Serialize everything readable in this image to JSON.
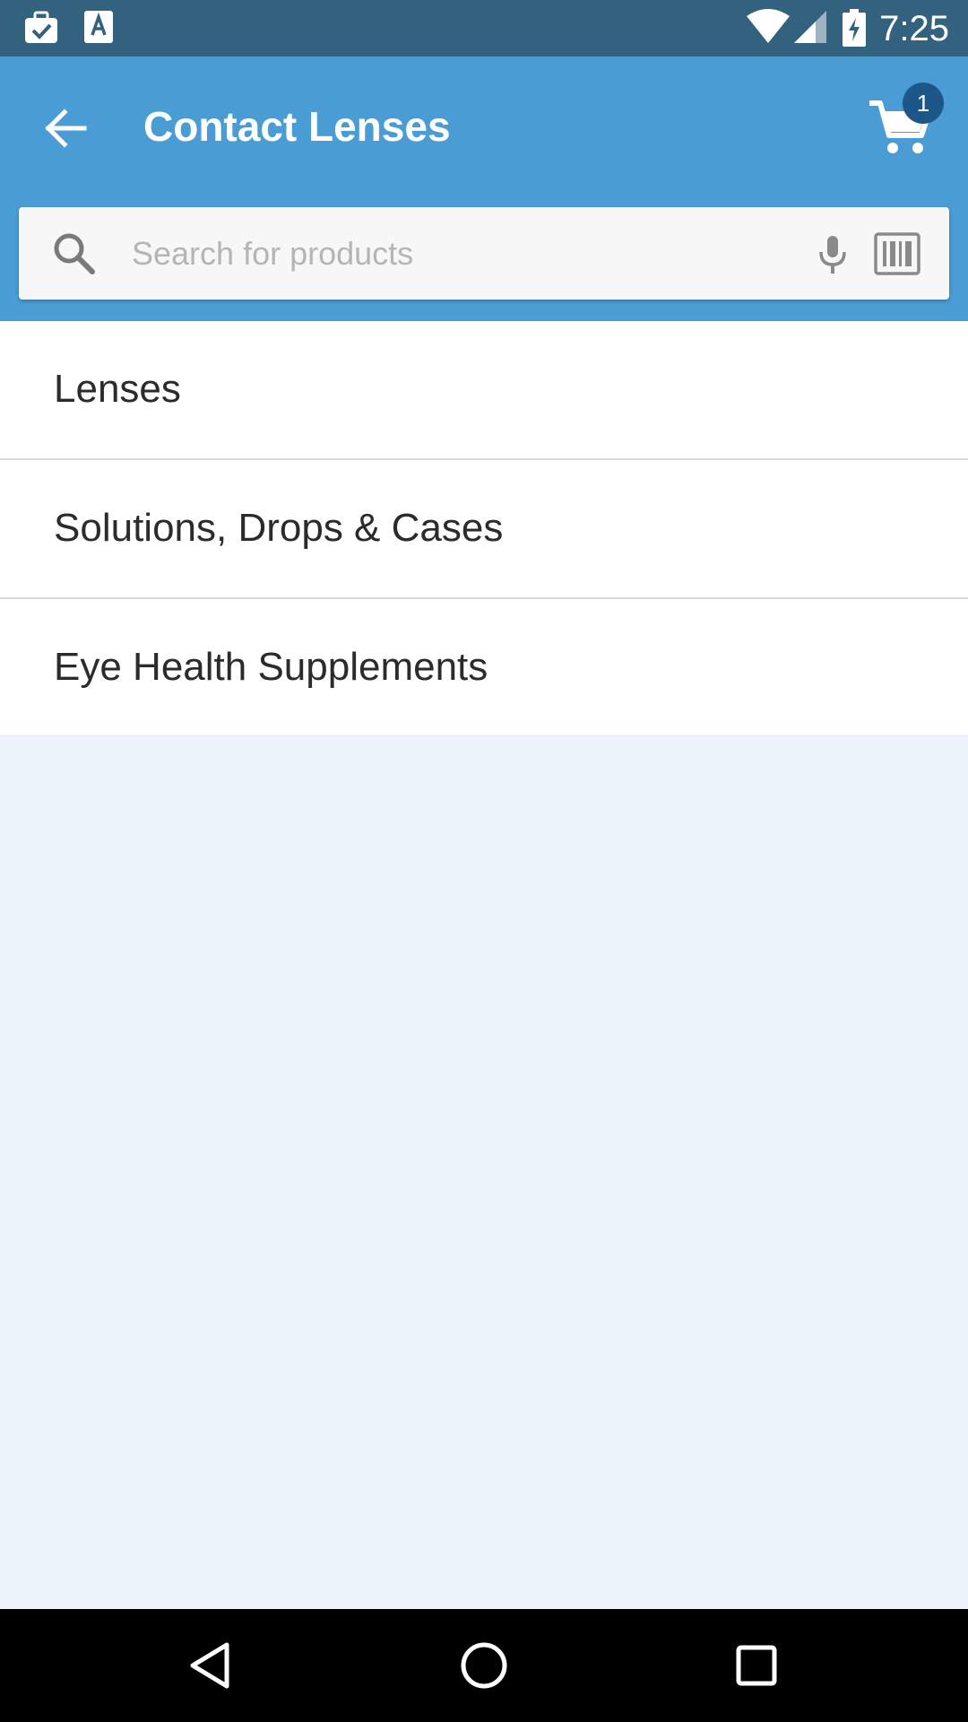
{
  "status_bar": {
    "time": "7:25",
    "icons": [
      "briefcase-check-icon",
      "font-a-icon",
      "wifi-icon",
      "signal-icon",
      "battery-charging-icon"
    ]
  },
  "app_bar": {
    "title": "Contact Lenses",
    "cart_badge": "1",
    "color": "#4A9DD4"
  },
  "search": {
    "placeholder": "Search for products",
    "value": ""
  },
  "categories": [
    {
      "label": "Lenses"
    },
    {
      "label": "Solutions, Drops & Cases"
    },
    {
      "label": "Eye Health Supplements"
    }
  ],
  "nav": {
    "icons": [
      "back-triangle-icon",
      "home-circle-icon",
      "recents-square-icon"
    ]
  }
}
